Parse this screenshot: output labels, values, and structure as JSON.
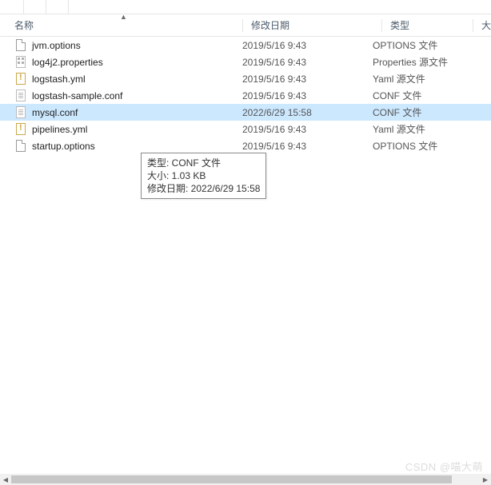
{
  "header": {
    "name": "名称",
    "date": "修改日期",
    "type": "类型",
    "extra": "大"
  },
  "files": [
    {
      "icon": "page",
      "name": "jvm.options",
      "date": "2019/5/16 9:43",
      "type": "OPTIONS 文件",
      "selected": false
    },
    {
      "icon": "prop",
      "name": "log4j2.properties",
      "date": "2019/5/16 9:43",
      "type": "Properties 源文件",
      "selected": false
    },
    {
      "icon": "yml",
      "name": "logstash.yml",
      "date": "2019/5/16 9:43",
      "type": "Yaml 源文件",
      "selected": false
    },
    {
      "icon": "conf",
      "name": "logstash-sample.conf",
      "date": "2019/5/16 9:43",
      "type": "CONF 文件",
      "selected": false
    },
    {
      "icon": "conf",
      "name": "mysql.conf",
      "date": "2022/6/29 15:58",
      "type": "CONF 文件",
      "selected": true
    },
    {
      "icon": "yml",
      "name": "pipelines.yml",
      "date": "2019/5/16 9:43",
      "type": "Yaml 源文件",
      "selected": false
    },
    {
      "icon": "page",
      "name": "startup.options",
      "date": "2019/5/16 9:43",
      "type": "OPTIONS 文件",
      "selected": false
    }
  ],
  "tooltip": {
    "line1": "类型: CONF 文件",
    "line2": "大小: 1.03 KB",
    "line3": "修改日期: 2022/6/29 15:58"
  },
  "watermark": "CSDN @喵大萌"
}
